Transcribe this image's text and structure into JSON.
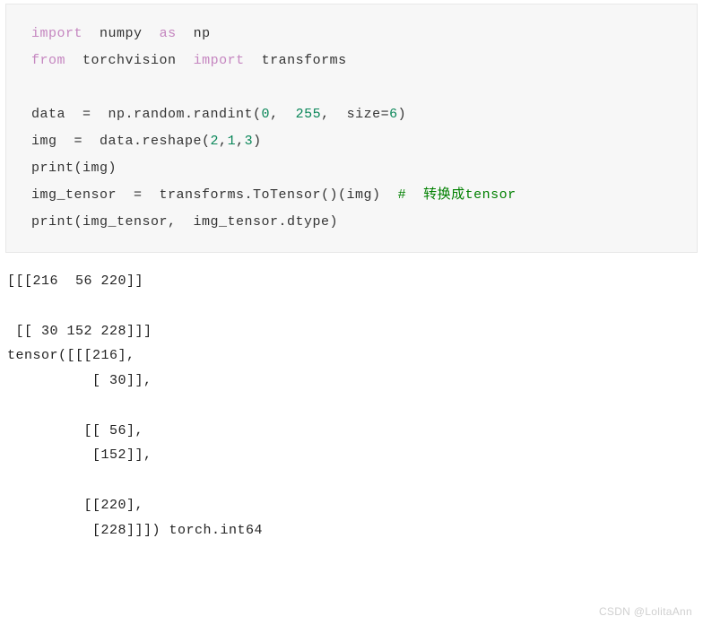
{
  "code": {
    "line1": {
      "kw1": "import",
      "sp1": "  ",
      "id1": "numpy",
      "sp2": "  ",
      "kw2": "as",
      "sp3": "  ",
      "id2": "np"
    },
    "line2": {
      "kw1": "from",
      "sp1": "  ",
      "id1": "torchvision",
      "sp2": "  ",
      "kw2": "import",
      "sp3": "  ",
      "id2": "transforms"
    },
    "line3": "",
    "line4": {
      "pre": "data  =  np.random.randint(",
      "n1": "0",
      "mid1": ",  ",
      "n2": "255",
      "mid2": ",  size=",
      "n3": "6",
      "end": ")"
    },
    "line5": {
      "pre": "img  =  data.reshape(",
      "n1": "2",
      "c1": ",",
      "n2": "1",
      "c2": ",",
      "n3": "3",
      "end": ")"
    },
    "line6": {
      "fn": "print",
      "args": "(img)"
    },
    "line7": {
      "pre": "img_tensor  =  transforms.ToTensor()(img)  ",
      "hash": "#",
      "comment": "  转换成tensor"
    },
    "line8": {
      "fn": "print",
      "args": "(img_tensor,  img_tensor.dtype)"
    }
  },
  "output": {
    "l1": "[[[216  56 220]]",
    "l2": "",
    "l3": " [[ 30 152 228]]]",
    "l4": "tensor([[[216],",
    "l5": "          [ 30]],",
    "l6": "",
    "l7": "         [[ 56],",
    "l8": "          [152]],",
    "l9": "",
    "l10": "         [[220],",
    "l11": "          [228]]]) torch.int64"
  },
  "watermark": "CSDN @LolitaAnn"
}
